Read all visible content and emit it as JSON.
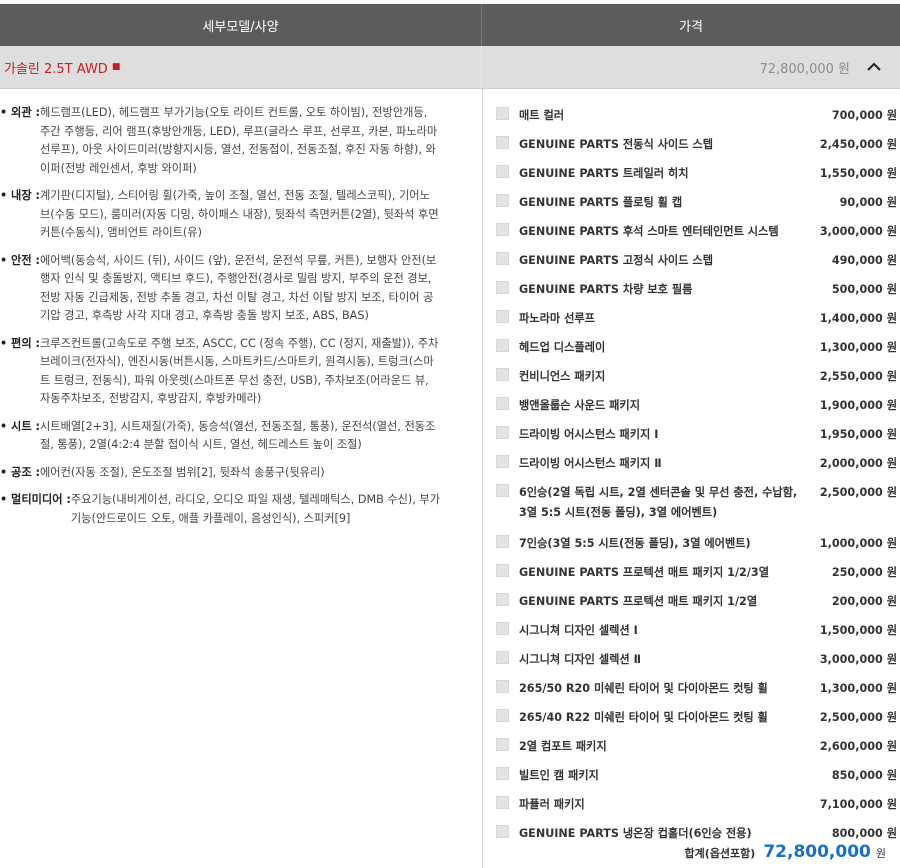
{
  "header": {
    "left_label": "세부모델/사양",
    "right_label": "가격"
  },
  "model": {
    "name": "가솔린 2.5T AWD",
    "marker": "■",
    "price": "72,800,000 원"
  },
  "specs": [
    {
      "title": "• 외관 : ",
      "text": "헤드램프(LED), 헤드램프 부가기능(오토 라이트 컨트롤, 오토 하이빔), 전방안개등, 주간 주행등, 리어 램프(후방안개등, LED), 루프(글라스 루프, 선루프, 카본, 파노라마 선루프), 아웃 사이드미러(방향지시등, 열선, 전동접이, 전동조절, 후진 자동 하향), 와이퍼(전방 레인센서, 후방 와이퍼)"
    },
    {
      "title": "• 내장 : ",
      "text": "계기판(디지털), 스티어링 휠(가죽, 높이 조절, 열선, 전동 조절, 텔레스코픽), 기어노브(수동 모드), 룸미러(자동 디밍, 하이패스 내장), 뒷좌석 측면커튼(2열), 뒷좌석 후면커튼(수동식), 앰비언트 라이트(유)"
    },
    {
      "title": "• 안전 : ",
      "text": "에어백(동승석, 사이드 (뒤), 사이드 (앞), 운전석, 운전석 무릎, 커튼), 보행자 안전(보행자 인식 및 충돌방지, 액티브 후드), 주행안전(경사로 밀림 방지, 부주의 운전 경보, 전방 자동 긴급제동, 전방 추돌 경고, 차선 이탈 경고, 차선 이탈 방지 보조, 타이어 공기압 경고, 후측방 사각 지대 경고, 후측방 충돌 방지 보조, ABS, BAS)"
    },
    {
      "title": "• 편의 : ",
      "text": "크루즈컨트롤(고속도로 주행 보조, ASCC, CC (정속 주행), CC (정지, 재출발)), 주차 브레이크(전자식), 엔진시동(버튼시동, 스마트카드/스마트키, 원격시동), 트렁크(스마트 트렁크, 전동식), 파워 아웃렛(스마트폰 무선 충전, USB), 주차보조(어라운드 뷰, 자동주차보조, 전방감지, 후방감지, 후방카메라)"
    },
    {
      "title": "• 시트 : ",
      "text": "시트배열[2+3], 시트재질(가죽), 동승석(열선, 전동조절, 통풍), 운전석(열선, 전동조절, 통풍), 2열(4:2:4 분할 접이식 시트, 열선, 헤드레스트 높이 조절)"
    },
    {
      "title": "• 공조 : ",
      "text": "에어컨(자동 조절), 온도조절 범위[2], 뒷좌석 송풍구(뒷유리)"
    },
    {
      "title": "• 멀티미디어 : ",
      "text": "주요기능(내비게이션, 라디오, 오디오 파일 재생, 텔레매틱스, DMB 수신), 부가기능(안드로이드 오토, 애플 카플레이, 음성인식), 스피커[9]"
    }
  ],
  "options": [
    {
      "name": "매트 컬러",
      "price": "700,000 원"
    },
    {
      "name": "GENUINE PARTS 전동식 사이드 스텝",
      "price": "2,450,000 원"
    },
    {
      "name": "GENUINE PARTS 트레일러 히치",
      "price": "1,550,000 원"
    },
    {
      "name": "GENUINE PARTS 플로팅 휠 캡",
      "price": "90,000 원"
    },
    {
      "name": "GENUINE PARTS 후석 스마트 엔터테인먼트 시스템",
      "price": "3,000,000 원"
    },
    {
      "name": "GENUINE PARTS 고정식 사이드 스텝",
      "price": "490,000 원"
    },
    {
      "name": "GENUINE PARTS 차량 보호 필름",
      "price": "500,000 원"
    },
    {
      "name": "파노라마 선루프",
      "price": "1,400,000 원"
    },
    {
      "name": "헤드업 디스플레이",
      "price": "1,300,000 원"
    },
    {
      "name": "컨비니언스 패키지",
      "price": "2,550,000 원"
    },
    {
      "name": "뱅앤올룹슨 사운드 패키지",
      "price": "1,900,000 원"
    },
    {
      "name": "드라이빙 어시스턴스 패키지 Ⅰ",
      "price": "1,950,000 원"
    },
    {
      "name": "드라이빙 어시스턴스 패키지 Ⅱ",
      "price": "2,000,000 원"
    },
    {
      "name": "6인승(2열 독립 시트, 2열 센터콘솔 및 무선 충전, 수납함, 3열 5:5 시트(전동 폴딩), 3열 에어벤트)",
      "price": "2,500,000 원"
    },
    {
      "name": "7인승(3열 5:5 시트(전동 폴딩), 3열 에어벤트)",
      "price": "1,000,000 원"
    },
    {
      "name": "GENUINE PARTS 프로텍션 매트 패키지 1/2/3열",
      "price": "250,000 원"
    },
    {
      "name": "GENUINE PARTS 프로텍션 매트 패키지 1/2열",
      "price": "200,000 원"
    },
    {
      "name": "시그니쳐 디자인 셀렉션 Ⅰ",
      "price": "1,500,000 원"
    },
    {
      "name": "시그니쳐 디자인 셀렉션 Ⅱ",
      "price": "3,000,000 원"
    },
    {
      "name": "265/50 R20 미쉐린 타이어 및 다이아몬드 컷팅 휠",
      "price": "1,300,000 원"
    },
    {
      "name": "265/40 R22 미쉐린 타이어 및 다이아몬드 컷팅 휠",
      "price": "2,500,000 원"
    },
    {
      "name": "2열 컴포트 패키지",
      "price": "2,600,000 원"
    },
    {
      "name": "빌트인 캠 패키지",
      "price": "850,000 원"
    },
    {
      "name": "파퓰러 패키지",
      "price": "7,100,000 원"
    },
    {
      "name": "GENUINE PARTS 냉온장 컵홀더(6인승 전용)",
      "price": "800,000 원"
    }
  ],
  "total": {
    "label": "합계(옵션포함)",
    "value": "72,800,000",
    "unit": "원"
  },
  "colors": {
    "header_bg": "#5c5c5c",
    "model_row_bg": "#dedede",
    "model_name": "#c81e1e",
    "total_value": "#1a6fc9"
  },
  "icons": {
    "collapse": "chevron-up-icon"
  }
}
